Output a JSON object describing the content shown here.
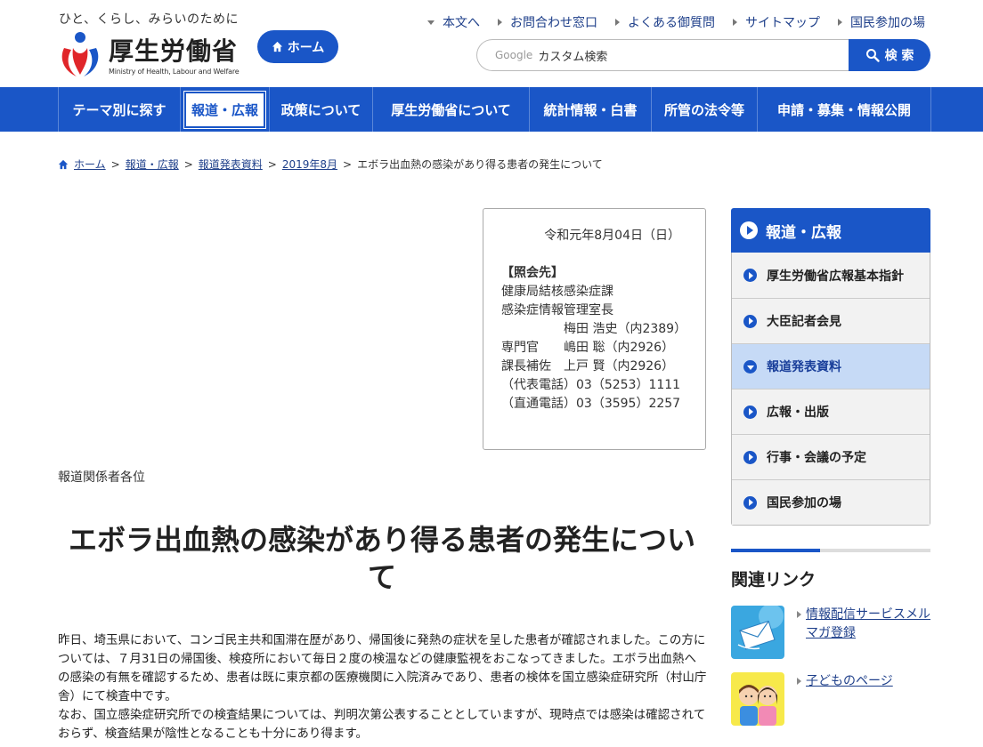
{
  "header": {
    "tagline": "ひと、くらし、みらいのために",
    "logo_name": "厚生労働省",
    "logo_en": "Ministry of Health, Labour and Welfare",
    "home_label": "ホーム",
    "util_links": [
      "本文へ",
      "お問合わせ窓口",
      "よくある御質問",
      "サイトマップ",
      "国民参加の場"
    ],
    "search_brand": "Google",
    "search_placeholder": "カスタム検索",
    "search_button": "検 索"
  },
  "gnav": {
    "items": [
      "テーマ別に探す",
      "報道・広報",
      "政策について",
      "厚生労働省について",
      "統計情報・白書",
      "所管の法令等",
      "申請・募集・情報公開"
    ]
  },
  "breadcrumb": {
    "items": [
      "ホーム",
      "報道・広報",
      "報道発表資料",
      "2019年8月"
    ],
    "current": "エボラ出血熱の感染があり得る患者の発生について"
  },
  "contact": {
    "date": "令和元年8月04日（日）",
    "heading": "【照会先】",
    "lines": [
      "健康局結核感染症課",
      "感染症情報管理室長",
      "　　　　　梅田 浩史（内2389）",
      "専門官　　嶋田 聡（内2926）",
      "課長補佐　上戸 賢（内2926）",
      "（代表電話）03（5253）1111",
      "（直通電話）03（3595）2257"
    ]
  },
  "article": {
    "recipients": "報道関係者各位",
    "title": "エボラ出血熱の感染があり得る患者の発生について",
    "paragraphs": [
      "昨日、埼玉県において、コンゴ民主共和国滞在歴があり、帰国後に発熱の症状を呈した患者が確認されました。この方については、７月31日の帰国後、検疫所において毎日２度の検温などの健康監視をおこなってきました。エボラ出血熱への感染の有無を確認するため、患者は既に東京都の医療機関に入院済みであり、患者の検体を国立感染症研究所（村山庁舎）にて検査中です。",
      "なお、国立感染症研究所での検査結果については、判明次第公表することとしていますが、現時点では感染は確認されておらず、検査結果が陰性となることも十分にあり得ます。"
    ]
  },
  "sidebar": {
    "heading": "報道・広報",
    "items": [
      "厚生労働省広報基本指針",
      "大臣記者会見",
      "報道発表資料",
      "広報・出版",
      "行事・会議の予定",
      "国民参加の場"
    ],
    "active_index": 2
  },
  "related": {
    "title": "関連リンク",
    "links": [
      "情報配信サービスメルマガ登録",
      "子どものページ"
    ]
  },
  "colors": {
    "brand_blue": "#1a56c7",
    "link": "#1e3f8a",
    "sidebar_active": "#c6daf6"
  }
}
